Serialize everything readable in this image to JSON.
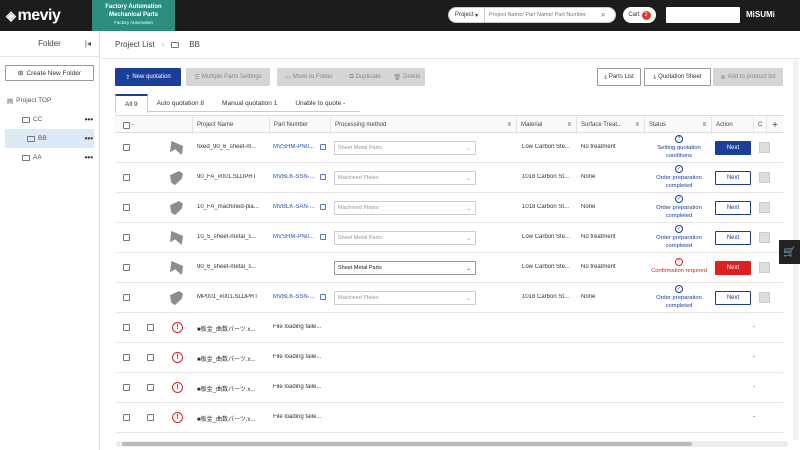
{
  "header": {
    "logo": "meviy",
    "product_line1": "Factory Automation",
    "product_line2": "Mechanical Parts",
    "product_line3": "Factory Automation",
    "search_scope": "Project",
    "search_placeholder": "Project Name/ Part Name/ Part Number",
    "cart_label": "Cart",
    "cart_count": "2",
    "brand": "MiSUMi"
  },
  "sidebar": {
    "title": "Folder",
    "new_folder": "Create New Folder",
    "root": "Project TOP",
    "folders": [
      {
        "label": "CC",
        "selected": false
      },
      {
        "label": "BB",
        "selected": true
      },
      {
        "label": "AA",
        "selected": false
      }
    ]
  },
  "breadcrumb": {
    "root": "Project List",
    "current": "BB"
  },
  "toolbar": {
    "new_quotation": "New quotation",
    "multiple_settings": "Multiple Parts Settings",
    "move_to_folder": "Move to Folder",
    "duplicate": "Duplicate",
    "delete": "Delete",
    "parts_list": "Parts List",
    "quotation_sheet": "Quotation Sheet",
    "add_to_product_list": "Add to product list"
  },
  "tabs": [
    {
      "label": "All",
      "count": "9",
      "active": true
    },
    {
      "label": "Auto quotation",
      "count": "8",
      "active": false
    },
    {
      "label": "Manual quotation",
      "count": "1",
      "active": false
    },
    {
      "label": "Unable to quote",
      "count": "-",
      "active": false
    }
  ],
  "columns": {
    "select": "-",
    "project_name": "Project Name",
    "part_number": "Part Number",
    "processing_method": "Processing method",
    "material": "Material",
    "surface_treatment": "Surface Treat...",
    "status": "Status",
    "action": "Action",
    "extra": "C"
  },
  "rows": [
    {
      "name": "fixed_90_6_sheet-m...",
      "part": "MVSHM-PN0...",
      "method": "Sheet Metal Parts",
      "material": "Low Carbon Ste...",
      "surface": "No treatment",
      "status1": "Setting quotation",
      "status2": "conditions",
      "status_icon": "?",
      "action": "Next"
    },
    {
      "name": "90_FA_#001.SLDPRT",
      "part": "MVBLK-SSN-...",
      "method": "Machined Plates",
      "material": "1018 Carbon St...",
      "surface": "None",
      "status1": "Order preparation",
      "status2": "completed",
      "status_icon": "✓",
      "action": "Next"
    },
    {
      "name": "10_FA_machined-pla...",
      "part": "MVBLK-SAN-...",
      "method": "Machined Plates",
      "material": "1018 Carbon St...",
      "surface": "None",
      "status1": "Order preparation",
      "status2": "completed",
      "status_icon": "✓",
      "action": "Next"
    },
    {
      "name": "10_5_sheet-metal_s...",
      "part": "MVSHM-PN0...",
      "method": "Sheet Metal Parts",
      "material": "Low Carbon Ste...",
      "surface": "No treatment",
      "status1": "Order preparation",
      "status2": "completed",
      "status_icon": "✓",
      "action": "Next"
    },
    {
      "name": "90_6_sheet-metal_s...",
      "part": "",
      "method": "Sheet Metal Parts",
      "material": "Low Carbon Ste...",
      "surface": "No treatment",
      "status1": "Confirmation required",
      "status2": "",
      "status_icon": "!",
      "action": "Next"
    },
    {
      "name": "MP001_#001.SLDPRT",
      "part": "MVBLK-SSN-...",
      "method": "Machined Plates",
      "material": "1018 Carbon St...",
      "surface": "None",
      "status1": "Order preparation",
      "status2": "completed",
      "status_icon": "✓",
      "action": "Next"
    }
  ],
  "error_rows": [
    {
      "name": "■板金_曲数パーツ.x...",
      "msg": "File loading faile...",
      "dash": "-"
    },
    {
      "name": "■板金_曲数パーツ.x...",
      "msg": "File loading faile...",
      "dash": "-"
    },
    {
      "name": "■板金_曲数パーツ.x...",
      "msg": "File loading faile...",
      "dash": "-"
    },
    {
      "name": "■板金_曲数パーツ.x...",
      "msg": "File loading faile...",
      "dash": "-"
    }
  ]
}
